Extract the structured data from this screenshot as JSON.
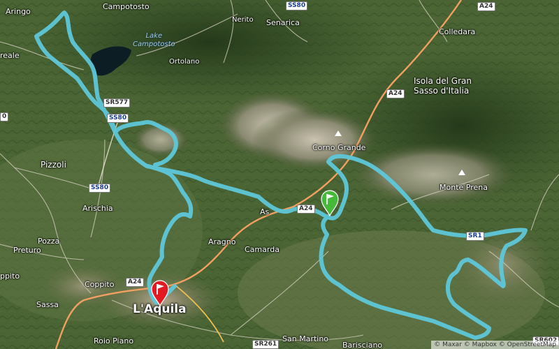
{
  "map": {
    "places": [
      {
        "id": "aringo",
        "name": "Aringo"
      },
      {
        "id": "campotosto",
        "name": "Campotosto"
      },
      {
        "id": "lake",
        "name": "Lake\nCampotosto"
      },
      {
        "id": "ortolano",
        "name": "Ortolano"
      },
      {
        "id": "nerito",
        "name": "Nerito"
      },
      {
        "id": "senarica",
        "name": "Senarica"
      },
      {
        "id": "colledara",
        "name": "Colledara"
      },
      {
        "id": "isola",
        "name": "Isola del Gran\nSasso d'Italia"
      },
      {
        "id": "reale",
        "name": "reale"
      },
      {
        "id": "cornogrande",
        "name": "Corno Grande"
      },
      {
        "id": "monteprena",
        "name": "Monte Prena"
      },
      {
        "id": "pizzoli",
        "name": "Pizzoli"
      },
      {
        "id": "arischia",
        "name": "Arischia"
      },
      {
        "id": "pozza",
        "name": "Pozza"
      },
      {
        "id": "preturo",
        "name": "Preturo"
      },
      {
        "id": "coppito",
        "name": "Coppito"
      },
      {
        "id": "sassa",
        "name": "Sassa"
      },
      {
        "id": "ppito",
        "name": "ppito"
      },
      {
        "id": "aragno",
        "name": "Aragno"
      },
      {
        "id": "camarda",
        "name": "Camarda"
      },
      {
        "id": "assergi",
        "name": "As"
      },
      {
        "id": "laquila",
        "name": "L'Aquila"
      },
      {
        "id": "roiopiano",
        "name": "Roio Piano"
      },
      {
        "id": "sanmartino",
        "name": "San Martino"
      },
      {
        "id": "barisciano",
        "name": "Barisciano"
      }
    ],
    "road_shields": [
      {
        "id": "a24-ne",
        "label": "A24",
        "color": "white"
      },
      {
        "id": "ss80-top",
        "label": "SS80",
        "color": "blue"
      },
      {
        "id": "a24-isola",
        "label": "A24",
        "color": "white"
      },
      {
        "id": "sr577",
        "label": "SR577",
        "color": "white"
      },
      {
        "id": "ss80-mid",
        "label": "SS80",
        "color": "blue"
      },
      {
        "id": "ss80-pizzoli",
        "label": "SS80",
        "color": "blue"
      },
      {
        "id": "a24-tunnel",
        "label": "A24",
        "color": "white"
      },
      {
        "id": "sr17",
        "label": "SR1",
        "color": "blue"
      },
      {
        "id": "a24-laquila",
        "label": "A24",
        "color": "white"
      },
      {
        "id": "sr261",
        "label": "SR261",
        "color": "white"
      },
      {
        "id": "sr602",
        "label": "SR602",
        "color": "white"
      },
      {
        "id": "edge-left",
        "label": "0",
        "color": "white"
      }
    ],
    "markers": {
      "start": {
        "label": "start-flag",
        "color": "#e21b23"
      },
      "end": {
        "label": "end-flag",
        "color": "#46b93a"
      }
    },
    "route_color": "#5ec7d9",
    "attribution": "© Maxar © Mapbox © OpenStreetMap"
  }
}
